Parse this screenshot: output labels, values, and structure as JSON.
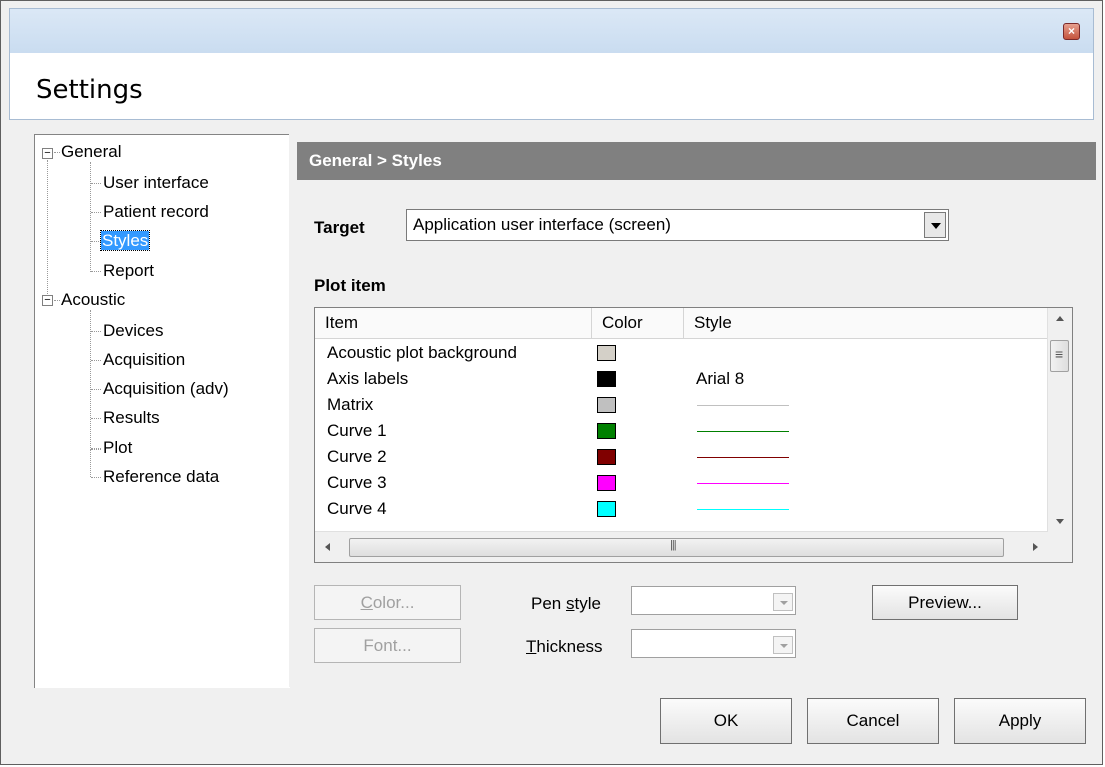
{
  "window": {
    "title": "Settings",
    "close_icon": "close-icon"
  },
  "tree": {
    "general": {
      "label": "General",
      "children": [
        "User interface",
        "Patient record",
        "Styles",
        "Report"
      ]
    },
    "acoustic": {
      "label": "Acoustic",
      "children": [
        "Devices",
        "Acquisition",
        "Acquisition (adv)",
        "Results",
        "Plot",
        "Reference data"
      ]
    },
    "selected": "Styles",
    "collapse_glyph": "−"
  },
  "panel": {
    "header": "General > Styles",
    "target_label": "Target",
    "target_value": "Application user interface (screen)",
    "plot_item_label": "Plot item"
  },
  "list": {
    "columns": [
      "Item",
      "Color",
      "Style"
    ],
    "rows": [
      {
        "item": "Acoustic plot background",
        "color": "#d4d0c8",
        "style_text": "",
        "line_color": ""
      },
      {
        "item": "Axis labels",
        "color": "#000000",
        "style_text": "Arial  8",
        "line_color": ""
      },
      {
        "item": "Matrix",
        "color": "#c0c0c0",
        "style_text": "",
        "line_color": "#c0c0c0"
      },
      {
        "item": "Curve 1",
        "color": "#008000",
        "style_text": "",
        "line_color": "#008000"
      },
      {
        "item": "Curve 2",
        "color": "#800000",
        "style_text": "",
        "line_color": "#800000"
      },
      {
        "item": "Curve 3",
        "color": "#ff00ff",
        "style_text": "",
        "line_color": "#ff00ff"
      },
      {
        "item": "Curve 4",
        "color": "#00ffff",
        "style_text": "",
        "line_color": "#00ffff"
      }
    ]
  },
  "controls": {
    "color_button": {
      "first": "C",
      "rest": "olor..."
    },
    "font_button": "Font...",
    "pen_style": {
      "before": "Pen ",
      "key": "s",
      "after": "tyle"
    },
    "thickness": {
      "key": "T",
      "after": "hickness"
    },
    "preview_button": "Preview..."
  },
  "footer": {
    "ok": "OK",
    "cancel": "Cancel",
    "apply": "Apply"
  }
}
